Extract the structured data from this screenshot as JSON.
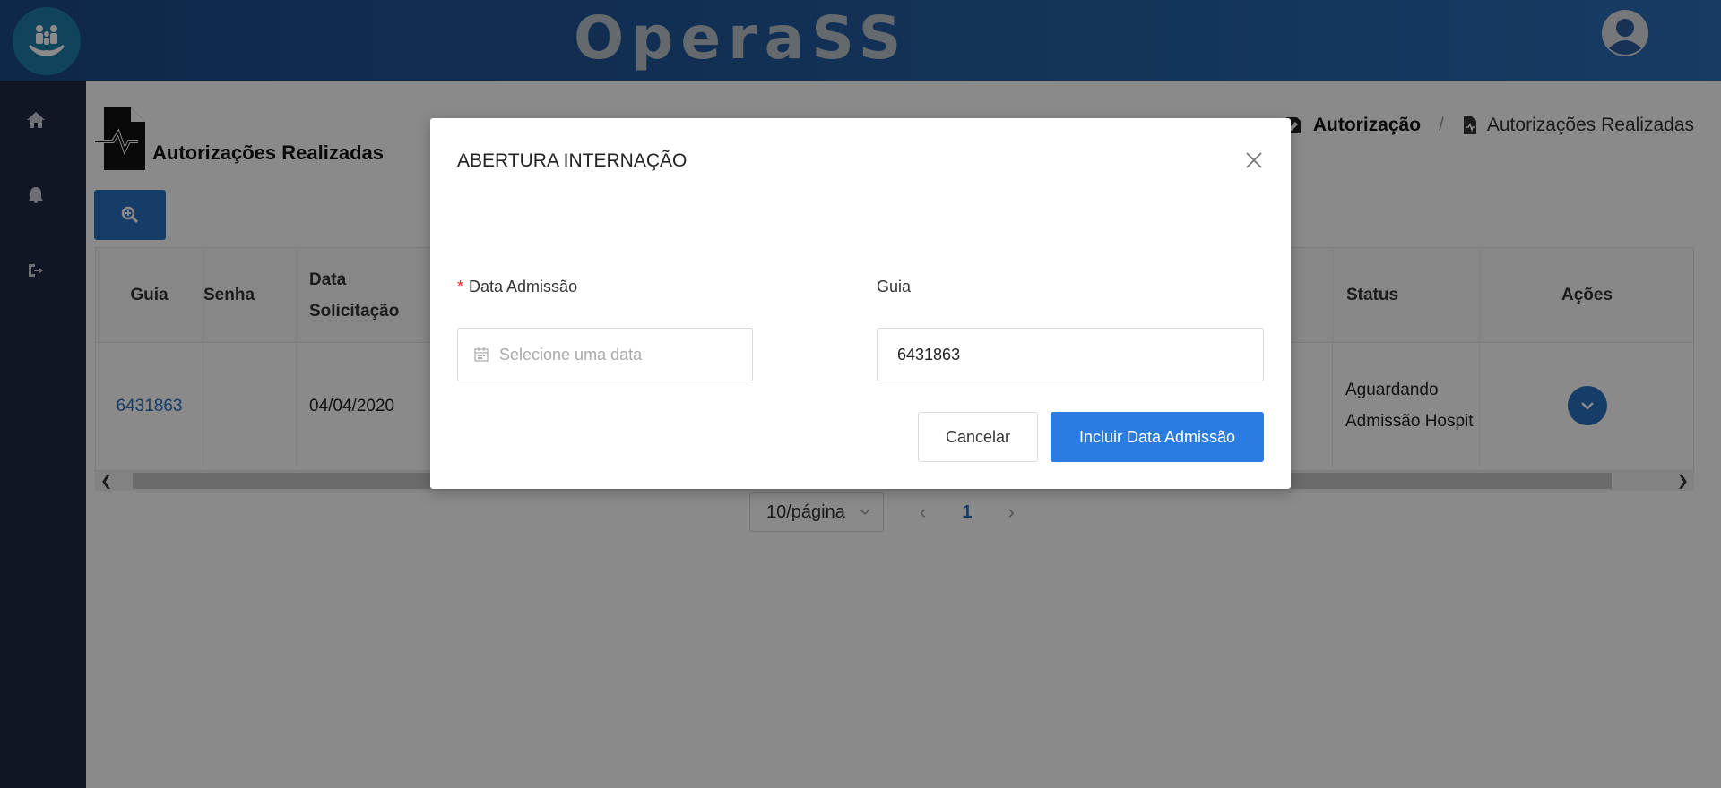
{
  "header": {
    "title": "OperaSS"
  },
  "sidebar": {
    "items": [
      {
        "icon": "home-icon"
      },
      {
        "icon": "bell-icon"
      },
      {
        "icon": "logout-icon"
      }
    ]
  },
  "page": {
    "title": "Autorizações Realizadas",
    "breadcrumb": [
      {
        "label": "Autorização",
        "icon": "signature-icon"
      },
      {
        "label": "Autorizações Realizadas",
        "icon": "file-medical-icon"
      }
    ],
    "breadcrumb_separator": "/"
  },
  "table": {
    "headers": {
      "guia": "Guia",
      "senha": "Senha",
      "data_solicitacao_1": "Data",
      "data_solicitacao_2": "Solicitação",
      "status": "Status",
      "acoes": "Ações"
    },
    "rows": [
      {
        "guia": "6431863",
        "senha": "",
        "data_solicitacao": "04/04/2020",
        "status_1": "Aguardando",
        "status_2": "Admissão Hospit"
      }
    ]
  },
  "pagination": {
    "page_size": "10/página",
    "current_page": "1"
  },
  "modal": {
    "title": "ABERTURA INTERNAÇÃO",
    "fields": {
      "data_admissao": {
        "label": "Data Admissão",
        "required_mark": "*",
        "placeholder": "Selecione uma data",
        "value": ""
      },
      "guia": {
        "label": "Guia",
        "value": "6431863"
      }
    },
    "buttons": {
      "cancel": "Cancelar",
      "confirm": "Incluir Data Admissão"
    }
  },
  "colors": {
    "header_start": "#1b4a86",
    "header_end": "#2b6db8",
    "sidebar": "#1f2a44",
    "primary": "#2a7ce0",
    "required": "#f5222d"
  }
}
